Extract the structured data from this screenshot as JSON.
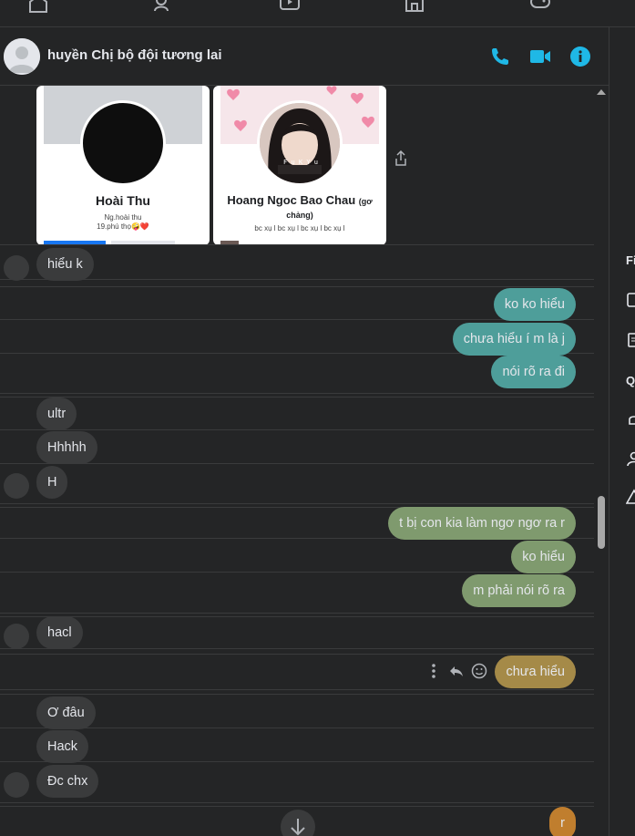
{
  "header": {
    "contact_name": "huyền Chị bộ đội tương lai"
  },
  "right_panel": {
    "label_1": "Fi",
    "label_2": "Q"
  },
  "shared_profiles": [
    {
      "name": "Hoài Thu",
      "sub1": "Ng.hoài thu",
      "sub2": "19.phú thọ🤪❤️"
    },
    {
      "name": "Hoang Ngoc Bao Chau",
      "name_suffix": "(gơ chảng)",
      "sub1": "bc xụ l bc xụ l bc xụ l bc xụ l",
      "photo_caption": "F u  K  Y  u"
    }
  ],
  "messages": [
    {
      "side": "in",
      "text": "hiểu k"
    },
    {
      "side": "out",
      "text": "ko ko hiểu"
    },
    {
      "side": "out",
      "text": "chưa hiểu í m là j"
    },
    {
      "side": "out",
      "text": "nói rõ ra đi"
    },
    {
      "side": "in",
      "text": "ultr"
    },
    {
      "side": "in",
      "text": "Hhhhh"
    },
    {
      "side": "in",
      "text": "H"
    },
    {
      "side": "out",
      "text": "t bị con kia làm ngơ ngơ ra r"
    },
    {
      "side": "out",
      "text": "ko hiểu"
    },
    {
      "side": "out",
      "text": "m phải nói rõ ra"
    },
    {
      "side": "in",
      "text": "hacl"
    },
    {
      "side": "out",
      "text": "chưa hiểu"
    },
    {
      "side": "in",
      "text": "Ơ đâu"
    },
    {
      "side": "in",
      "text": "Hack"
    },
    {
      "side": "in",
      "text": "Đc chx"
    },
    {
      "side": "out",
      "text": "r"
    }
  ],
  "colors": {
    "background": "#242526",
    "incoming_bubble": "#3a3b3c",
    "teal_bubble": "#4e9e9a",
    "sage_bubble": "#7f9a6e",
    "gold_bubble": "#a58a48",
    "orange_bubble": "#c07e2e",
    "accent_icon": "#1fb8e6"
  },
  "icons": [
    "home-icon",
    "friends-icon",
    "watch-icon",
    "marketplace-icon",
    "gaming-icon",
    "phone-icon",
    "video-camera-icon",
    "info-icon",
    "share-icon",
    "more-icon",
    "reply-icon",
    "emoji-icon",
    "arrow-down-icon"
  ]
}
